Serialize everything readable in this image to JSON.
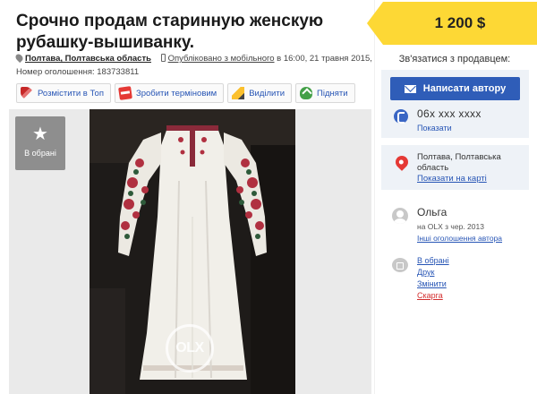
{
  "listing": {
    "title": "Срочно продам старинную женскую рубашку-вышиванку.",
    "price": "1 200 $",
    "location": "Полтава, Полтавська область",
    "mobile_label": "Опубліковано з мобільного",
    "published": "в 16:00, 21 травня 2015, Номер оголошення: 183733811"
  },
  "actions": [
    {
      "label": "Розмістити в Топ",
      "icon": "rocket-icon"
    },
    {
      "label": "Зробити терміновим",
      "icon": "urgent-tag-icon"
    },
    {
      "label": "Виділити",
      "icon": "highlight-pencil-icon"
    },
    {
      "label": "Підняти",
      "icon": "raise-up-icon"
    }
  ],
  "gallery": {
    "favorite_label": "В обрані",
    "watermark": "OLX"
  },
  "contact": {
    "title": "Зв'язатися з продавцем:",
    "write_button": "Написати автору",
    "phone": "06х ххх хххх",
    "show_phone": "Показати"
  },
  "location_panel": {
    "line1": "Полтава, Полтавська",
    "line2": "область",
    "map_link": "Показати на карті"
  },
  "seller": {
    "name": "Ольга",
    "since": "на OLX з чер. 2013",
    "other_ads": "Інші оголошення автора"
  },
  "links": [
    {
      "label": "В обрані",
      "style": "normal"
    },
    {
      "label": "Друк",
      "style": "normal"
    },
    {
      "label": "Змінити",
      "style": "normal"
    },
    {
      "label": "Скарга",
      "style": "danger"
    }
  ],
  "colors": {
    "price_bg": "#fdd835",
    "button_blue": "#2f5db8",
    "link_blue": "#2755b5",
    "panel_bg": "#eef2f7",
    "danger": "#d32f2f"
  }
}
